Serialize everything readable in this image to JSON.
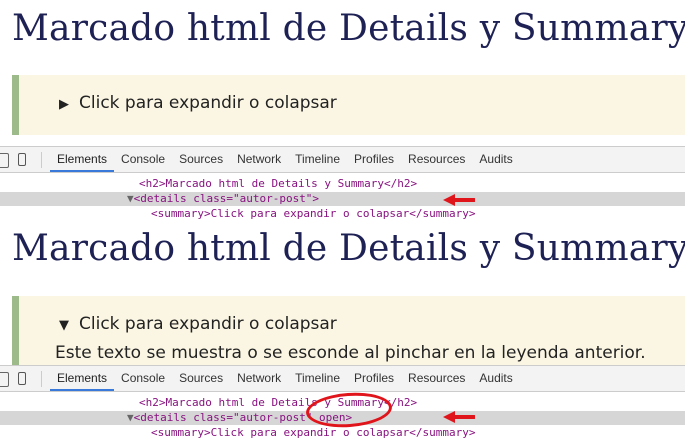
{
  "page": {
    "title": "Marcado html de Details y Summary",
    "summary_closed": "Click para expandir o colapsar",
    "summary_open": "Click para expandir o colapsar",
    "details_text": "Este texto se muestra o se esconde al pinchar en la leyenda anterior."
  },
  "devtools": {
    "tabs": [
      "Elements",
      "Console",
      "Sources",
      "Network",
      "Timeline",
      "Profiles",
      "Resources",
      "Audits"
    ],
    "active_tab": "Elements",
    "dom_top": {
      "h2_line": "<h2>Marcado html de Details y Summary</h2>",
      "details_line": "<details class=\"autor-post\">",
      "summary_line": "<summary>Click para expandir o colapsar</summary>"
    },
    "dom_bottom": {
      "h2_line": "<h2>Marcado html de Details y Summary</h2>",
      "details_line": "<details class=\"autor-post\" open>",
      "summary_line": "<summary>Click para expandir o colapsar</summary>"
    }
  },
  "colors": {
    "title": "#1e2154",
    "details_bg": "#fbf6e3",
    "details_border": "#9dba8b",
    "annotation_red": "#e0141b",
    "tab_active_underline": "#3879d9"
  },
  "icons": [
    "inspect-icon",
    "device-mode-icon",
    "triangle-right-icon",
    "triangle-down-icon",
    "red-arrow-annotation"
  ]
}
